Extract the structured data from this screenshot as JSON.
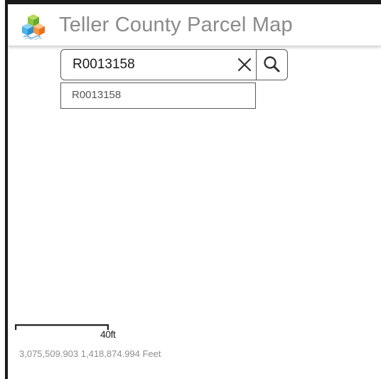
{
  "header": {
    "title": "Teller County Parcel Map",
    "logo_icon": "stacked-cubes-logo-icon"
  },
  "search": {
    "value": "R0013158",
    "clear_icon": "close-icon",
    "search_icon": "search-icon"
  },
  "suggestions": [
    {
      "label": "R0013158"
    }
  ],
  "map": {
    "scale_label": "40ft",
    "coordinates": "3,075,509.903 1,418,874.994 Feet"
  }
}
